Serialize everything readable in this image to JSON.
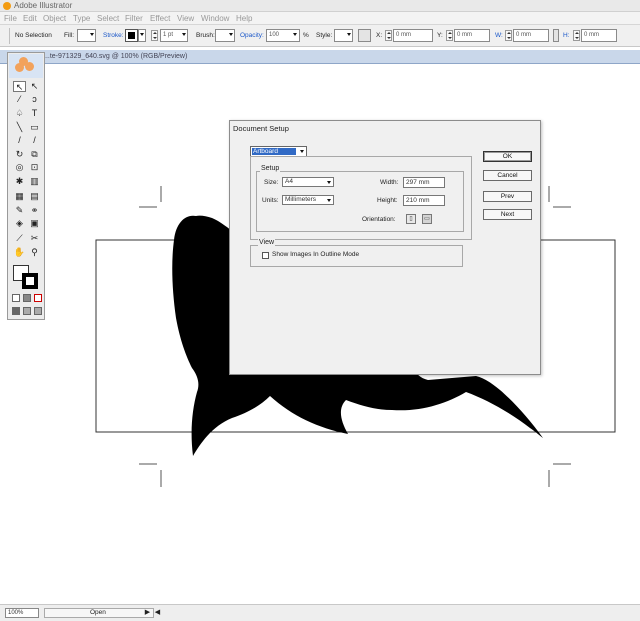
{
  "app": {
    "title": "Adobe Illustrator"
  },
  "menu": [
    "File",
    "Edit",
    "Object",
    "Type",
    "Select",
    "Filter",
    "Effect",
    "View",
    "Window",
    "Help"
  ],
  "control": {
    "selection": "No Selection",
    "fill_label": "Fill:",
    "stroke_label": "Stroke:",
    "stroke_weight": "1 pt",
    "brush_label": "Brush:",
    "opacity_label": "Opacity:",
    "opacity_value": "100",
    "opacity_unit": "%",
    "style_label": "Style:",
    "x_label": "X:",
    "x_value": "0 mm",
    "y_label": "Y:",
    "y_value": "0 mm",
    "w_label": "W:",
    "w_value": "0 mm",
    "h_label": "H:",
    "h_value": "0 mm"
  },
  "document": {
    "tab_title": "...te-971329_640.svg @ 100% (RGB/Preview)"
  },
  "status": {
    "zoom": "100%",
    "text": "Open"
  },
  "dialog": {
    "title": "Document Setup",
    "category": "Artboard",
    "setup_group": "Setup",
    "size_label": "Size:",
    "size_value": "A4",
    "units_label": "Units:",
    "units_value": "Millimeters",
    "width_label": "Width:",
    "width_value": "297 mm",
    "height_label": "Height:",
    "height_value": "210 mm",
    "orientation_label": "Orientation:",
    "view_group": "View",
    "outline_label": "Show Images In Outline Mode",
    "outline_checked": false,
    "buttons": {
      "ok": "OK",
      "cancel": "Cancel",
      "prev": "Prev",
      "next": "Next"
    }
  },
  "colors": {
    "accent_blue": "#316ac5",
    "doc_tab": "#c9d7ea",
    "dialog_bg": "#f0f0f0"
  }
}
